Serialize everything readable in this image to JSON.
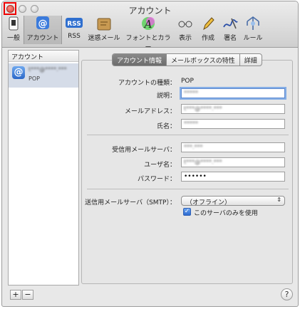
{
  "window": {
    "title": "アカウント"
  },
  "toolbar": [
    {
      "label": "一般",
      "icon": "switch-icon"
    },
    {
      "label": "アカウント",
      "icon": "at-icon"
    },
    {
      "label": "RSS",
      "icon": "rss-icon"
    },
    {
      "label": "迷惑メール",
      "icon": "junk-mail-icon"
    },
    {
      "label": "フォントとカラー",
      "icon": "font-color-icon"
    },
    {
      "label": "表示",
      "icon": "glasses-icon"
    },
    {
      "label": "作成",
      "icon": "pencil-icon"
    },
    {
      "label": "署名",
      "icon": "signature-icon"
    },
    {
      "label": "ルール",
      "icon": "rules-icon"
    }
  ],
  "sidebar": {
    "header": "アカウント",
    "account": {
      "name": "t***@****.***",
      "type": "POP"
    }
  },
  "tabs": [
    "アカウント情報",
    "メールボックスの特性",
    "詳細"
  ],
  "form": {
    "account_type_label": "アカウントの種類：",
    "account_type_value": "POP",
    "description_label": "説明：",
    "description_value": "*****",
    "email_label": "メールアドレス：",
    "email_value": "t***@****.***",
    "name_label": "氏名：",
    "name_value": "*****",
    "incoming_server_label": "受信用メールサーバ：",
    "incoming_server_value": "***.***",
    "username_label": "ユーザ名：",
    "username_value": "t***@****.***",
    "password_label": "パスワード：",
    "password_value": "••••••",
    "smtp_label": "送信用メールサーバ（SMTP）：",
    "smtp_value": "（オフライン）",
    "smtp_only_label": "このサーバのみを使用"
  },
  "buttons": {
    "add": "+",
    "remove": "−",
    "help": "?"
  },
  "colors": {
    "accent": "#2d6ad0",
    "close_highlight": "#ee0000"
  }
}
